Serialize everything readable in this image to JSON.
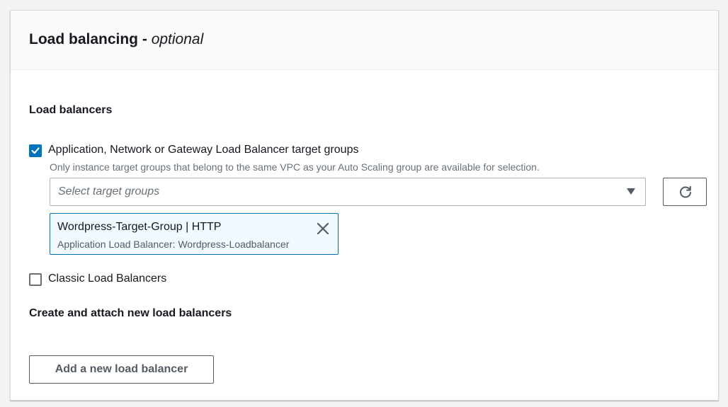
{
  "header": {
    "title_main": "Load balancing - ",
    "title_optional": "optional"
  },
  "load_balancers": {
    "label": "Load balancers",
    "target_groups_option": {
      "label": "Application, Network or Gateway Load Balancer target groups",
      "description": "Only instance target groups that belong to the same VPC as your Auto Scaling group are available for selection.",
      "checked": true
    },
    "select": {
      "placeholder": "Select target groups"
    },
    "selected_token": {
      "title": "Wordpress-Target-Group | HTTP",
      "subtitle": "Application Load Balancer: Wordpress-Loadbalancer"
    },
    "classic_option": {
      "label": "Classic Load Balancers",
      "checked": false
    }
  },
  "create_new": {
    "label": "Create and attach new load balancers",
    "button_label": "Add a new load balancer"
  },
  "colors": {
    "accent": "#0073bb",
    "token_bg": "#f1faff",
    "text": "#16191f",
    "muted": "#687078"
  }
}
